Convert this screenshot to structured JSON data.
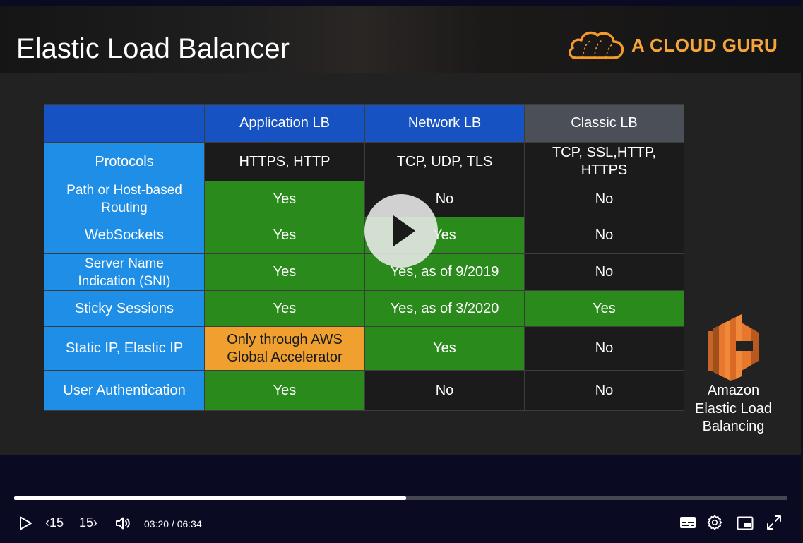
{
  "slide": {
    "title": "Elastic Load Balancer",
    "brand": "A CLOUD GURU",
    "aws_label": [
      "Amazon",
      "Elastic Load",
      "Balancing"
    ]
  },
  "table": {
    "headers": [
      "",
      "Application LB",
      "Network LB",
      "Classic LB"
    ],
    "rows": [
      {
        "label": "Protocols",
        "cells": [
          "HTTPS, HTTP",
          "TCP, UDP, TLS",
          "TCP, SSL,HTTP, HTTPS"
        ]
      },
      {
        "label": "Path or Host-based Routing",
        "cells": [
          "Yes",
          "No",
          "No"
        ]
      },
      {
        "label": "WebSockets",
        "cells": [
          "Yes",
          "Yes",
          "No"
        ]
      },
      {
        "label": "Server Name Indication (SNI)",
        "cells": [
          "Yes",
          "Yes, as of 9/2019",
          "No"
        ]
      },
      {
        "label": "Sticky Sessions",
        "cells": [
          "Yes",
          "Yes, as of 3/2020",
          "Yes"
        ]
      },
      {
        "label": "Static IP, Elastic IP",
        "cells": [
          "Only through AWS Global Accelerator",
          "Yes",
          "No"
        ]
      },
      {
        "label": "User Authentication",
        "cells": [
          "Yes",
          "No",
          "No"
        ]
      }
    ]
  },
  "player": {
    "current_time": "03:20",
    "duration": "06:34",
    "time_display": "03:20 / 06:34",
    "progress_fraction": 0.507,
    "skip_back_label": "15",
    "skip_forward_label": "15",
    "icons": [
      "play-icon",
      "rewind-15-icon",
      "forward-15-icon",
      "volume-icon",
      "captions-icon",
      "settings-icon",
      "picture-in-picture-icon",
      "fullscreen-icon"
    ]
  },
  "colors": {
    "header_blue": "#1652c1",
    "row_label_blue": "#1e8ee6",
    "yes_green": "#2b8a1c",
    "partial_orange": "#efa02f",
    "classic_header_gray": "#4b4f57",
    "brand_orange": "#f6a53a",
    "aws_orange": "#e8772e"
  }
}
